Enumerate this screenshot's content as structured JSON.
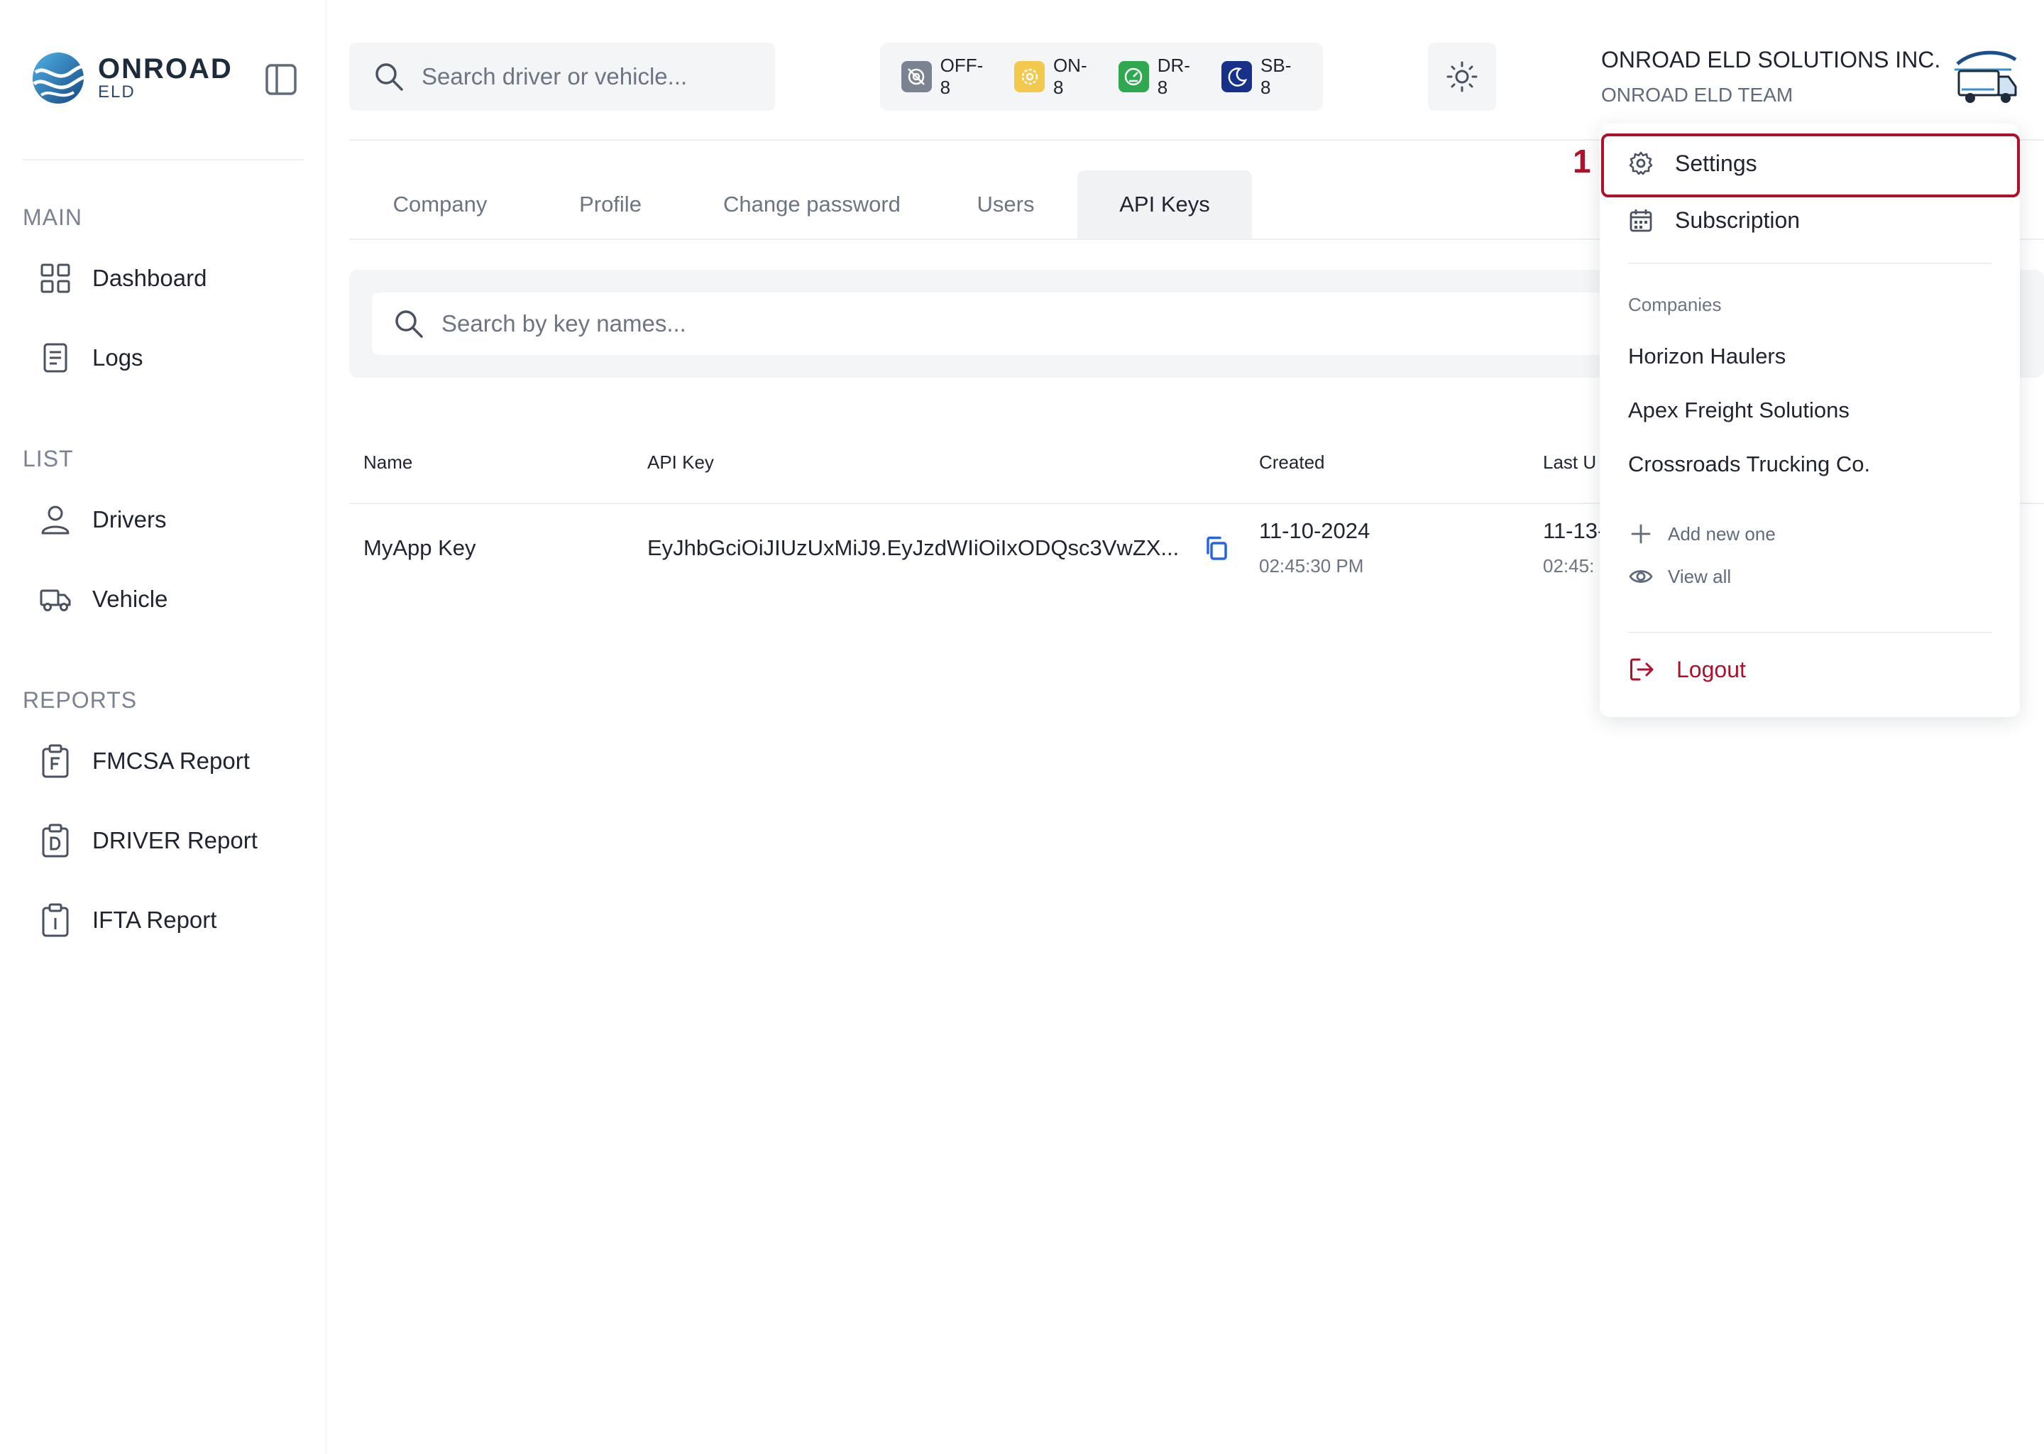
{
  "brand": {
    "title": "ONROAD",
    "subtitle": "ELD"
  },
  "sidebar": {
    "sections": [
      {
        "title": "MAIN",
        "items": [
          {
            "label": "Dashboard",
            "icon": "grid-icon"
          },
          {
            "label": "Logs",
            "icon": "document-icon"
          }
        ]
      },
      {
        "title": "LIST",
        "items": [
          {
            "label": "Drivers",
            "icon": "user-icon"
          },
          {
            "label": "Vehicle",
            "icon": "truck-icon"
          }
        ]
      },
      {
        "title": "REPORTS",
        "items": [
          {
            "label": "FMCSA Report",
            "icon": "clipboard-f-icon"
          },
          {
            "label": "DRIVER Report",
            "icon": "clipboard-d-icon"
          },
          {
            "label": "IFTA Report",
            "icon": "clipboard-i-icon"
          }
        ]
      }
    ]
  },
  "header": {
    "search_placeholder": "Search driver or vehicle...",
    "statuses": [
      {
        "label": "OFF-8",
        "color": "#7b8390"
      },
      {
        "label": "ON-8",
        "color": "#f2c94c"
      },
      {
        "label": "DR-8",
        "color": "#2fa84f"
      },
      {
        "label": "SB-8",
        "color": "#17318a"
      }
    ],
    "company_name": "ONROAD ELD SOLUTIONS INC.",
    "team_name": "ONROAD ELD TEAM"
  },
  "tabs": [
    {
      "label": "Company",
      "active": false
    },
    {
      "label": "Profile",
      "active": false
    },
    {
      "label": "Change password",
      "active": false
    },
    {
      "label": "Users",
      "active": false
    },
    {
      "label": "API Keys",
      "active": true
    }
  ],
  "key_search": {
    "placeholder": "Search by key names..."
  },
  "table": {
    "columns": [
      "Name",
      "API Key",
      "Created",
      "Last U"
    ],
    "rows": [
      {
        "name": "MyApp Key",
        "api_key": "EyJhbGciOiJIUzUxMiJ9.EyJzdWIiOiIxODQsc3VwZX...",
        "created_date": "11-10-2024",
        "created_time": "02:45:30 PM",
        "last_used_date": "11-13-",
        "last_used_time": "02:45:"
      }
    ]
  },
  "dropdown": {
    "step_number": "1",
    "settings_label": "Settings",
    "subscription_label": "Subscription",
    "companies_caption": "Companies",
    "companies": [
      "Horizon Haulers",
      "Apex Freight Solutions",
      "Crossroads Trucking Co."
    ],
    "add_new_label": "Add new one",
    "view_all_label": "View all",
    "logout_label": "Logout"
  },
  "colors": {
    "accent": "#b0102a",
    "brand_blue": "#1f6fb4",
    "copy_icon": "#2563eb"
  }
}
